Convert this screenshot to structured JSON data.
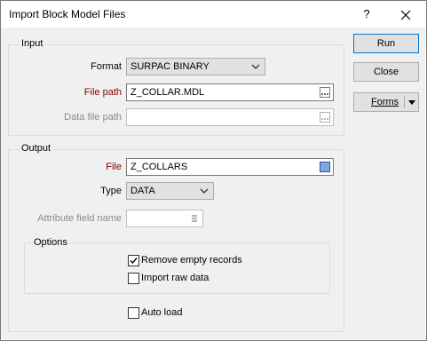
{
  "window": {
    "title": "Import Block Model Files",
    "help_glyph": "?",
    "close_icon": "close-icon"
  },
  "input_group": {
    "label": "Input",
    "format_label": "Format",
    "format_value": "SURPAC BINARY",
    "file_path_label": "File path",
    "file_path_value": "Z_COLLAR.MDL",
    "data_file_path_label": "Data file path",
    "data_file_path_value": ""
  },
  "output_group": {
    "label": "Output",
    "file_label": "File",
    "file_value": "Z_COLLARS",
    "type_label": "Type",
    "type_value": "DATA",
    "attribute_label": "Attribute field name",
    "attribute_value": ""
  },
  "options_group": {
    "label": "Options",
    "remove_empty_label": "Remove empty records",
    "remove_empty_checked": true,
    "import_raw_label": "Import raw data",
    "import_raw_checked": false
  },
  "auto_load": {
    "label": "Auto load",
    "checked": false
  },
  "buttons": {
    "run": "Run",
    "close": "Close",
    "forms": "Forms"
  },
  "colors": {
    "required_label": "#800000",
    "accent": "#0078d7",
    "disabled_text": "#8a8a8a"
  }
}
